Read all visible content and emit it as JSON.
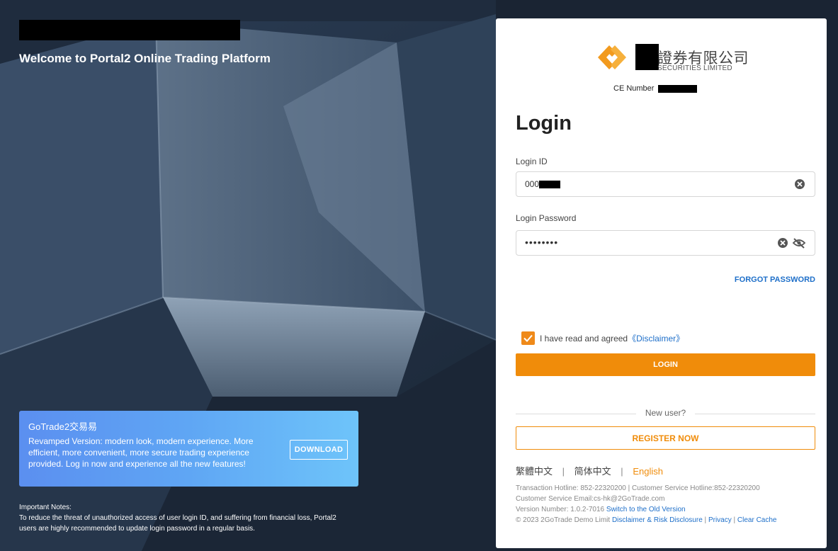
{
  "left": {
    "welcome_title": "Welcome to Portal2 Online Trading Platform",
    "promo": {
      "title": "GoTrade2交易易",
      "text": "Revamped Version: modern look, modern experience. More efficient, more convenient, more secure trading experience provided. Log in now and experience all the new features!",
      "download_label": "DOWNLOAD"
    },
    "notes": {
      "heading": "Important Notes:",
      "text": "To reduce the threat of unauthorized access of user login ID, and suffering from financial loss, Portal2 users are highly recommended to update login password in a regular basis."
    }
  },
  "panel": {
    "logo_cn": "證券有限公司",
    "logo_en": "SECURITIES LIMITED",
    "ce_label": "CE Number",
    "title": "Login",
    "login_id": {
      "label": "Login ID",
      "value": "000"
    },
    "password": {
      "label": "Login Password",
      "value": "••••••••"
    },
    "forgot_label": "FORGOT PASSWORD",
    "agree": {
      "text": "I have read and agreed",
      "link": "《Disclaimer》",
      "checked": true
    },
    "login_label": "LOGIN",
    "new_user": "New user?",
    "register_label": "REGISTER NOW",
    "languages": {
      "tc": "繁體中文",
      "sc": "简体中文",
      "en": "English",
      "sep": "|"
    },
    "footer": {
      "hotline": "Transaction Hotline: 852-22320200 | Customer Service Hotline:852-22320200",
      "email": "Customer Service Email:cs-hk@2GoTrade.com",
      "version_text": "Version Number: 1.0.2-7016",
      "old_version_link": "Switch to the Old Version",
      "copyright": "© 2023 2GoTrade Demo Limit",
      "disclaimer_link": "Disclaimer & Risk Disclosure",
      "privacy_link": "Privacy",
      "clear_cache_link": "Clear Cache",
      "sep": "|"
    },
    "colors": {
      "accent": "#f08c0a",
      "link": "#1e6fc9"
    }
  }
}
